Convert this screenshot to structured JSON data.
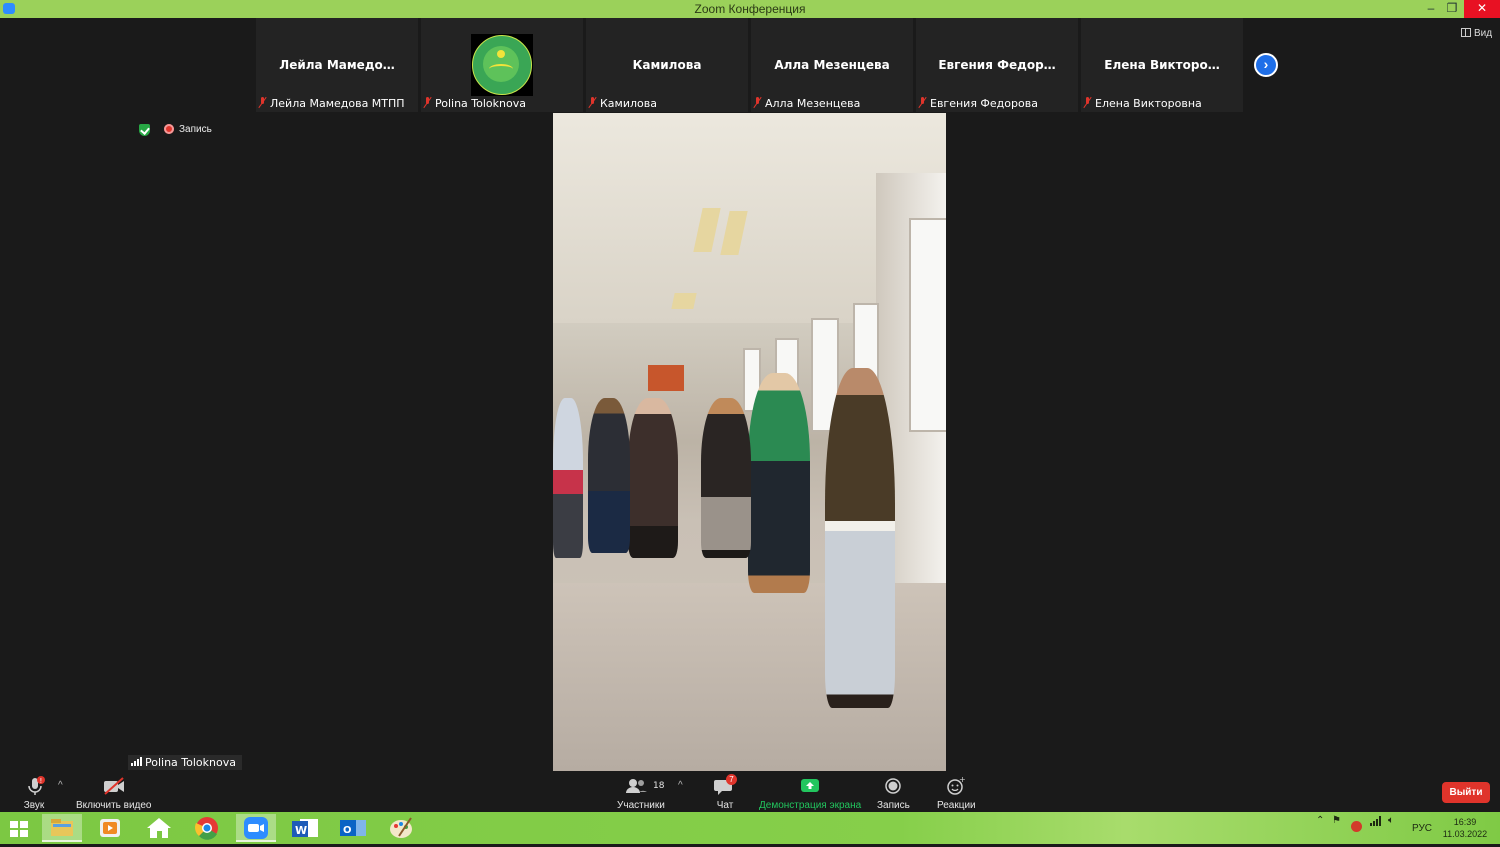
{
  "window": {
    "title": "Zoom Конференция",
    "minimize_icon": "minimize-icon",
    "maximize_icon": "restore-icon",
    "close_icon": "close-icon"
  },
  "participants_strip": [
    {
      "display_name": "Лейла  Мамедо…",
      "label": "Лейла Мамедова МТПП",
      "has_avatar": false
    },
    {
      "display_name": "",
      "label": "Polina Toloknova",
      "has_avatar": true
    },
    {
      "display_name": "Камилова",
      "label": "Камилова",
      "has_avatar": false
    },
    {
      "display_name": "Алла Мезенцева",
      "label": "Алла Мезенцева",
      "has_avatar": false
    },
    {
      "display_name": "Евгения  Федор…",
      "label": "Евгения Федорова",
      "has_avatar": false
    },
    {
      "display_name": "Елена  Викторо…",
      "label": "Елена Викторовна",
      "has_avatar": false
    }
  ],
  "view_button": "Вид",
  "recording_indicator": "Запись",
  "active_speaker": "Polina Toloknova",
  "toolbar": {
    "audio_label": "Звук",
    "video_label": "Включить видео",
    "participants_label": "Участники",
    "participants_count": "18",
    "chat_label": "Чат",
    "chat_unread": "7",
    "share_label": "Демонстрация экрана",
    "record_label": "Запись",
    "reactions_label": "Реакции",
    "leave_label": "Выйти"
  },
  "taskbar": {
    "language": "РУС",
    "time": "16:39",
    "date": "11.03.2022"
  },
  "colors": {
    "titlebar": "#9bd15a",
    "accent_blue": "#1f6fe8",
    "share_green": "#22c55e",
    "danger_red": "#e0342b",
    "taskbar_green": "#7cc843"
  }
}
